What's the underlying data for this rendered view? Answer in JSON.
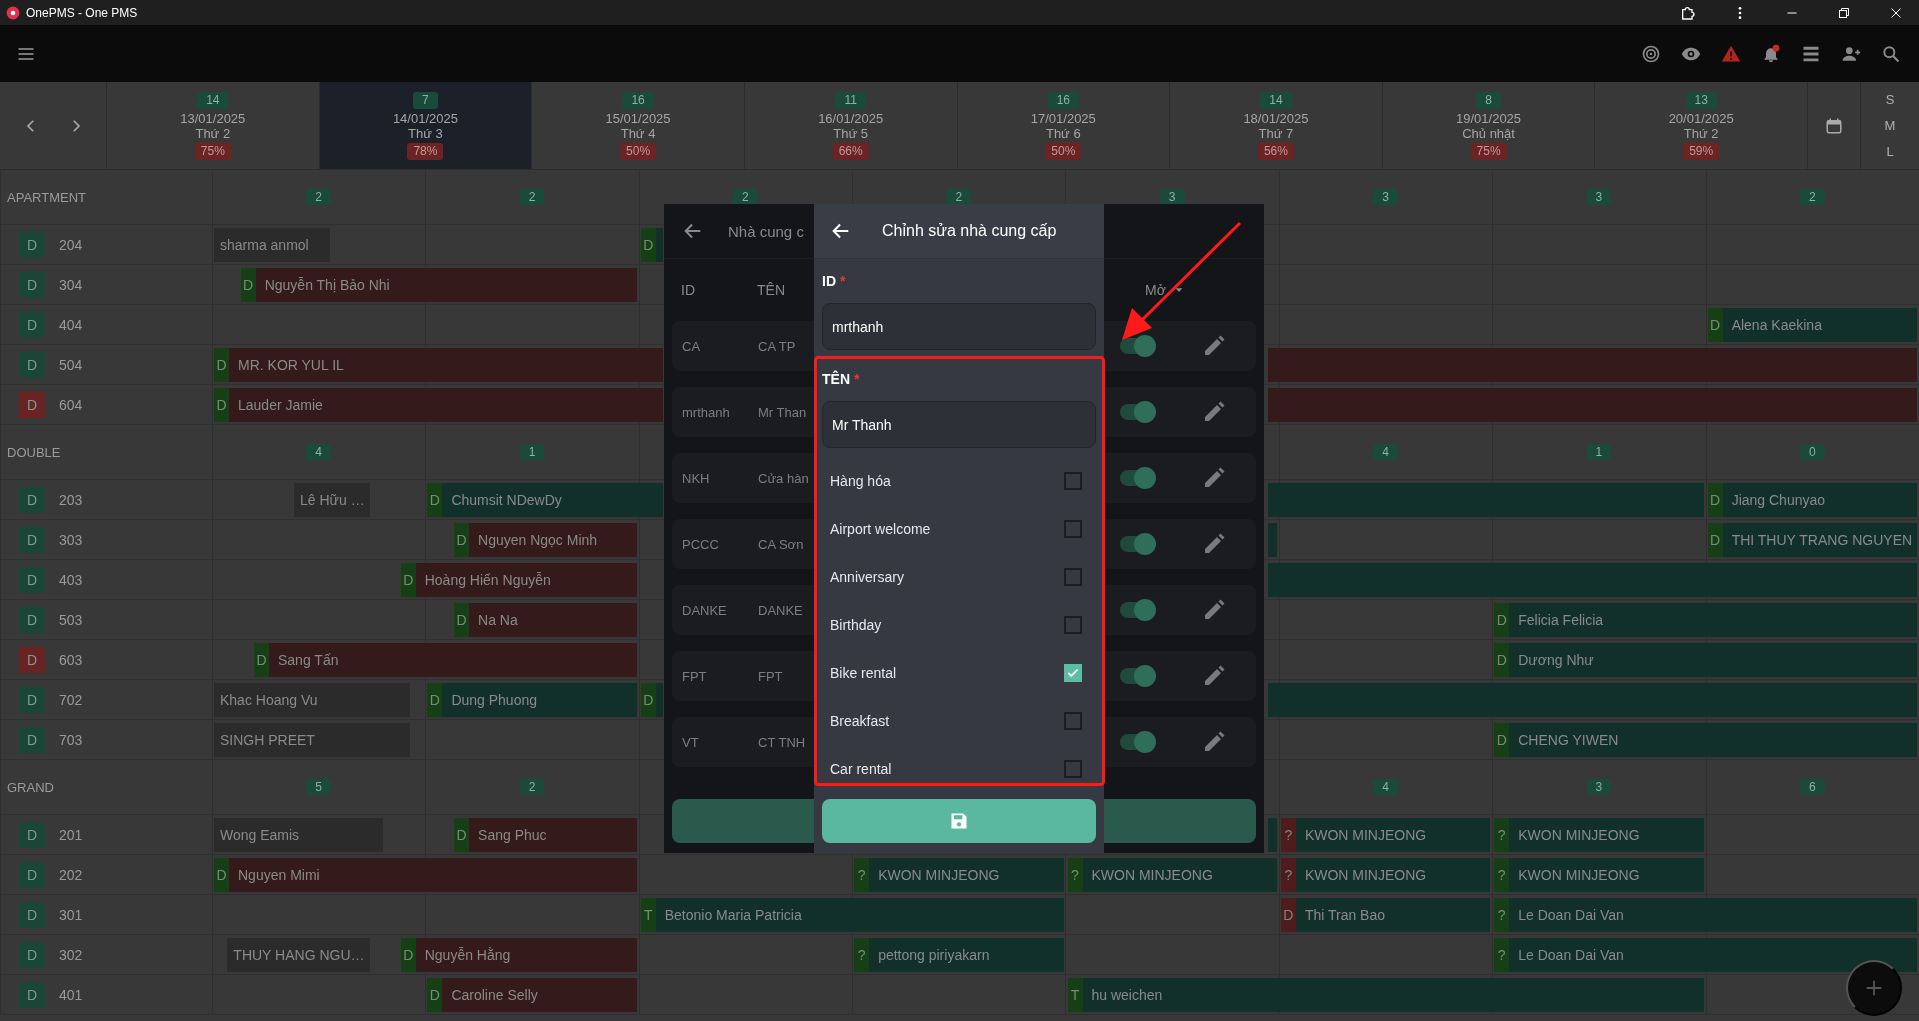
{
  "window": {
    "title": "OnePMS - One PMS"
  },
  "days": [
    {
      "count": "14",
      "date": "13/01/2025",
      "weekday": "Thứ 2",
      "occupancy": "75%",
      "selected": false
    },
    {
      "count": "7",
      "date": "14/01/2025",
      "weekday": "Thứ 3",
      "occupancy": "78%",
      "selected": true
    },
    {
      "count": "16",
      "date": "15/01/2025",
      "weekday": "Thứ 4",
      "occupancy": "50%",
      "selected": false
    },
    {
      "count": "11",
      "date": "16/01/2025",
      "weekday": "Thứ 5",
      "occupancy": "66%",
      "selected": false
    },
    {
      "count": "16",
      "date": "17/01/2025",
      "weekday": "Thứ 6",
      "occupancy": "50%",
      "selected": false
    },
    {
      "count": "14",
      "date": "18/01/2025",
      "weekday": "Thứ 7",
      "occupancy": "56%",
      "selected": false
    },
    {
      "count": "8",
      "date": "19/01/2025",
      "weekday": "Chủ nhật",
      "occupancy": "75%",
      "selected": false
    },
    {
      "count": "13",
      "date": "20/01/2025",
      "weekday": "Thứ 2",
      "occupancy": "59%",
      "selected": false
    }
  ],
  "size_options": [
    "S",
    "M",
    "L"
  ],
  "sections": [
    {
      "name": "APARTMENT",
      "counts": [
        "2",
        "2",
        "2",
        "2",
        "3",
        "3",
        "3",
        "2"
      ],
      "rooms": [
        {
          "number": "204",
          "tag": "D",
          "color": "#1a4637",
          "bookings": [
            {
              "name": "sharma anmol",
              "color": "#2b2b2b"
            },
            {
              "tag": {
                "label": "D",
                "color": "#163f16"
              },
              "color": "#12302a"
            }
          ]
        },
        {
          "number": "304",
          "tag": "D",
          "color": "#1a4637",
          "bookings": [
            {
              "tag": {
                "label": "D",
                "color": "#163f16"
              },
              "name": "Nguyễn Thị Bảo Nhi",
              "color": "#341a1a"
            }
          ]
        },
        {
          "number": "404",
          "tag": "D",
          "color": "#1a4637",
          "bookings": [
            {
              "tag": {
                "label": "D",
                "color": "#163f16"
              },
              "name": "Alena Kaekina",
              "color": "#12302a"
            }
          ]
        },
        {
          "number": "504",
          "tag": "D",
          "color": "#1a4637",
          "bookings": [
            {
              "tag": {
                "label": "D",
                "color": "#163f16"
              },
              "name": "MR. KOR YUL IL",
              "color": "#341a1a"
            },
            {
              "color": "#341a1a"
            }
          ]
        },
        {
          "number": "604",
          "tag": "D",
          "color": "#6a2323",
          "bookings": [
            {
              "tag": {
                "label": "D",
                "color": "#163f16"
              },
              "name": "Lauder Jamie",
              "color": "#341a1a"
            },
            {
              "color": "#341a1a"
            }
          ]
        }
      ]
    },
    {
      "name": "DOUBLE",
      "counts": [
        "4",
        "1",
        "4",
        "1",
        "0"
      ],
      "rooms": [
        {
          "number": "203",
          "tag": "D",
          "color": "#1a4637",
          "bookings": [
            {
              "name": "Lê Hữu …",
              "color": "#2b2b2b"
            },
            {
              "tag": {
                "label": "D",
                "color": "#163f16"
              },
              "name": "Chumsit NDewDy",
              "color": "#12302a"
            },
            {
              "color": "#12302a"
            },
            {
              "tag": {
                "label": "D",
                "color": "#163f16"
              },
              "name": "Jiang Chunyao",
              "color": "#12302a"
            }
          ]
        },
        {
          "number": "303",
          "tag": "D",
          "color": "#1a4637",
          "bookings": [
            {
              "tag": {
                "label": "D",
                "color": "#163f16"
              },
              "name": "Nguyen Ngọc Minh",
              "color": "#341a1a"
            },
            {
              "color": "#12302a"
            },
            {
              "tag": {
                "label": "D",
                "color": "#163f16"
              },
              "name": "THI THUY TRANG NGUYEN",
              "color": "#12302a"
            }
          ]
        },
        {
          "number": "403",
          "tag": "D",
          "color": "#1a4637",
          "bookings": [
            {
              "tag": {
                "label": "D",
                "color": "#163f16"
              },
              "name": "Hoàng Hiển Nguyễn",
              "color": "#341a1a"
            },
            {
              "color": "#12302a"
            }
          ]
        },
        {
          "number": "503",
          "tag": "D",
          "color": "#1a4637",
          "bookings": [
            {
              "tag": {
                "label": "D",
                "color": "#163f16"
              },
              "name": "Na Na",
              "color": "#341a1a"
            },
            {
              "tag": {
                "label": "D",
                "color": "#163f16"
              },
              "name": "Felicia Felicia",
              "color": "#12302a"
            }
          ]
        },
        {
          "number": "603",
          "tag": "D",
          "color": "#6a2323",
          "bookings": [
            {
              "tag": {
                "label": "D",
                "color": "#163f16"
              },
              "name": "Sang Tấn",
              "color": "#341a1a"
            },
            {
              "tag": {
                "label": "D",
                "color": "#163f16"
              },
              "name": "Dương Như",
              "color": "#12302a"
            }
          ]
        },
        {
          "number": "702",
          "tag": "D",
          "color": "#1a4637",
          "bookings": [
            {
              "name": "Khac Hoang Vu",
              "color": "#2b2b2b"
            },
            {
              "tag": {
                "label": "D",
                "color": "#163f16"
              },
              "name": "Dung Phuong",
              "color": "#12302a"
            },
            {
              "tag": {
                "label": "D",
                "color": "#163f16"
              },
              "color": "#12302a"
            },
            {
              "color": "#12302a"
            }
          ]
        },
        {
          "number": "703",
          "tag": "D",
          "color": "#1a4637",
          "bookings": [
            {
              "name": "SINGH PREET",
              "color": "#2b2b2b"
            },
            {
              "tag": {
                "label": "D",
                "color": "#163f16"
              },
              "name": "CHENG YIWEN",
              "color": "#12302a"
            }
          ]
        }
      ]
    },
    {
      "name": "GRAND",
      "counts": [
        "5",
        "2",
        "4",
        "3",
        "6"
      ],
      "rooms": [
        {
          "number": "201",
          "tag": "D",
          "color": "#1a4637",
          "bookings": [
            {
              "name": "Wong Eamis",
              "color": "#2b2b2b"
            },
            {
              "tag": {
                "label": "D",
                "color": "#163f16"
              },
              "name": "Sang Phuc",
              "color": "#341a1a"
            },
            {
              "color": "#12302a"
            },
            {
              "tag": {
                "label": "?",
                "color": "#4e1c1c"
              },
              "name": "KWON MINJEONG",
              "color": "#12302a"
            },
            {
              "tag": {
                "label": "?",
                "color": "#163f16"
              },
              "name": "KWON MINJEONG",
              "color": "#12302a"
            }
          ]
        },
        {
          "number": "202",
          "tag": "D",
          "color": "#1a4637",
          "bookings": [
            {
              "tag": {
                "label": "D",
                "color": "#163f16"
              },
              "name": "Nguyen Mimi",
              "color": "#341a1a"
            },
            {
              "tag": {
                "label": "?",
                "color": "#163f16"
              },
              "name": "KWON MINJEONG",
              "color": "#12302a"
            },
            {
              "tag": {
                "label": "?",
                "color": "#163f16"
              },
              "name": "KWON MINJEONG",
              "color": "#12302a"
            },
            {
              "tag": {
                "label": "?",
                "color": "#4e1c1c"
              },
              "name": "KWON MINJEONG",
              "color": "#12302a"
            },
            {
              "tag": {
                "label": "?",
                "color": "#163f16"
              },
              "name": "KWON MINJEONG",
              "color": "#12302a"
            }
          ]
        },
        {
          "number": "301",
          "tag": "D",
          "color": "#1a4637",
          "bookings": [
            {
              "tag": {
                "label": "T",
                "color": "#163f16"
              },
              "name": "Betonio Maria Patricia",
              "color": "#12302a"
            },
            {
              "tag": {
                "label": "D",
                "color": "#4e1c1c"
              },
              "name": "Thi Tran Bao",
              "color": "#12302a"
            },
            {
              "tag": {
                "label": "?",
                "color": "#163f16"
              },
              "name": "Le Doan Dai Van",
              "color": "#12302a"
            }
          ]
        },
        {
          "number": "302",
          "tag": "D",
          "color": "#1a4637",
          "bookings": [
            {
              "name": "THUY HANG NGU…",
              "color": "#2b2b2b"
            },
            {
              "tag": {
                "label": "D",
                "color": "#163f16"
              },
              "name": "Nguyễn Hằng",
              "color": "#341a1a"
            },
            {
              "tag": {
                "label": "?",
                "color": "#163f16"
              },
              "name": "pettong piriyakarn",
              "color": "#12302a"
            },
            {
              "tag": {
                "label": "?",
                "color": "#163f16"
              },
              "name": "Le Doan Dai Van",
              "color": "#12302a"
            }
          ]
        },
        {
          "number": "401",
          "tag": "D",
          "color": "#1a4637",
          "bookings": [
            {
              "tag": {
                "label": "D",
                "color": "#163f16"
              },
              "name": "Caroline Selly",
              "color": "#341a1a"
            },
            {
              "tag": {
                "label": "T",
                "color": "#163f16"
              },
              "name": "hu weichen",
              "color": "#12302a"
            }
          ]
        }
      ]
    }
  ],
  "supplier_list": {
    "title": "Nhà cung c",
    "columns": [
      "ID",
      "TÊN",
      "Mở"
    ],
    "rows": [
      {
        "id": "CA",
        "name": "CA TP",
        "on": true
      },
      {
        "id": "mrthanh",
        "name": "Mr Than",
        "on": true
      },
      {
        "id": "NKH",
        "name": "Cửa hàn",
        "on": true
      },
      {
        "id": "PCCC",
        "name": "CA Sơn",
        "on": true
      },
      {
        "id": "DANKE",
        "name": "DANKE",
        "on": true
      },
      {
        "id": "FPT",
        "name": "FPT",
        "on": true
      },
      {
        "id": "VT",
        "name": "CT TNH",
        "on": true
      }
    ]
  },
  "edit_dialog": {
    "title": "Chỉnh sửa nhà cung cấp",
    "fields": [
      {
        "label": "ID",
        "required_mark": "*",
        "value": "mrthanh"
      },
      {
        "label": "TÊN",
        "required_mark": "*",
        "value": "Mr Thanh"
      }
    ],
    "options": [
      {
        "label": "Hàng hóa",
        "checked": false
      },
      {
        "label": "Airport welcome",
        "checked": false
      },
      {
        "label": "Anniversary",
        "checked": false
      },
      {
        "label": "Birthday",
        "checked": false
      },
      {
        "label": "Bike rental",
        "checked": true
      },
      {
        "label": "Breakfast",
        "checked": false
      },
      {
        "label": "Car rental",
        "checked": false
      }
    ]
  }
}
